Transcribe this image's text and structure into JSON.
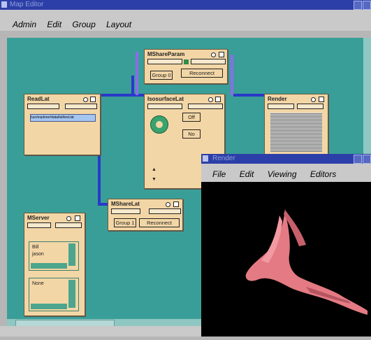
{
  "map_editor": {
    "title": "Map Editor",
    "menu": [
      "Admin",
      "Edit",
      "Group",
      "Layout"
    ],
    "title_buttons": [
      "☐",
      "☐"
    ]
  },
  "modules": {
    "mshareparam": {
      "title": "MShareParam",
      "group_label": "Group 0",
      "connect_label": "Reconnect"
    },
    "readlat": {
      "title": "ReadLat",
      "path_value": "/usr/explorer/data/lat/test.lat"
    },
    "isosurface": {
      "title": "IsosurfaceLat",
      "toggle1": "Off",
      "toggle2": "No"
    },
    "render": {
      "title": "Render"
    },
    "msharelat": {
      "title": "MShareLat",
      "group_label": "Group 1",
      "connect_label": "Reconnect"
    },
    "mserver": {
      "title": "MServer",
      "users": [
        "Bill",
        "jason"
      ],
      "list2": [
        "None"
      ]
    }
  },
  "render_window": {
    "title": "Render",
    "menu": [
      "File",
      "Edit",
      "Viewing",
      "Editors"
    ]
  },
  "colors": {
    "canvas": "#3a9e98",
    "module": "#f3d6a6",
    "titlebar": "#2c3fa8",
    "render_bg": "#000000",
    "surface": "#e57a82"
  }
}
